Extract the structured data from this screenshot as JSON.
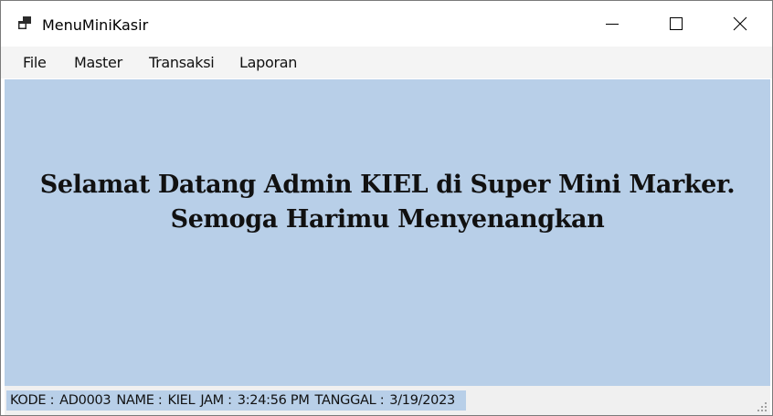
{
  "window": {
    "title": "MenuMiniKasir",
    "controls": {
      "minimize": "minimize-icon",
      "maximize": "maximize-icon",
      "close": "close-icon"
    }
  },
  "menu": {
    "items": [
      {
        "label": "File"
      },
      {
        "label": "Master"
      },
      {
        "label": "Transaksi"
      },
      {
        "label": "Laporan"
      }
    ]
  },
  "main": {
    "welcome_line1": "Selamat Datang Admin KIEL di Super Mini Marker.",
    "welcome_line2": "Semoga Harimu Menyenangkan",
    "background_color": "#b8cfe8"
  },
  "status": {
    "kode_label": "KODE :",
    "kode_value": "AD0003",
    "name_label": "NAME :",
    "name_value": "KIEL",
    "jam_label": "JAM :",
    "jam_value": "3:24:56 PM",
    "tanggal_label": "TANGGAL :",
    "tanggal_value": "3/19/2023"
  }
}
